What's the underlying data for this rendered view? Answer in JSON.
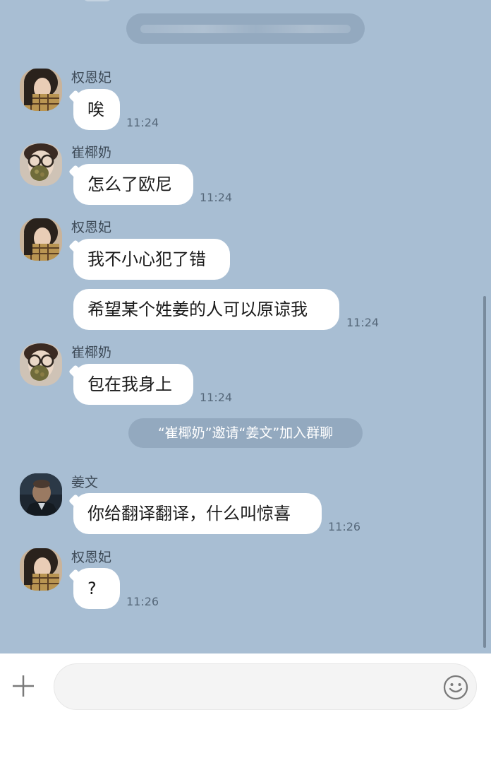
{
  "top_notice": {
    "text": ""
  },
  "messages": [
    {
      "sender": "权恩妃",
      "text": "唉",
      "time": "11:24",
      "avatar": "avatar-girl-photo"
    },
    {
      "sender": "崔椰奶",
      "text": "怎么了欧尼",
      "time": "11:24",
      "avatar": "avatar-glasses-photo"
    },
    {
      "sender": "权恩妃",
      "text": "我不小心犯了错",
      "avatar": "avatar-girl-photo"
    },
    {
      "text": "希望某个姓姜的人可以原谅我",
      "time": "11:24"
    },
    {
      "sender": "崔椰奶",
      "text": "包在我身上",
      "time": "11:24",
      "avatar": "avatar-glasses-photo"
    },
    {
      "system": "“崔椰奶”邀请“姜文”加入群聊"
    },
    {
      "sender": "姜文",
      "text": "你给翻译翻译，什么叫惊喜",
      "time": "11:26",
      "avatar": "avatar-man-photo"
    },
    {
      "sender": "权恩妃",
      "text": "?",
      "time": "11:26",
      "avatar": "avatar-girl-photo"
    }
  ],
  "composer": {
    "placeholder": "",
    "value": "",
    "left_icon": "plus-icon",
    "right_icon": "emoji-icon"
  },
  "colors": {
    "chat_background": "#a8bed3",
    "bubble": "#ffffff",
    "system_pill": "#93a9bf",
    "timestamp": "#56687a"
  }
}
